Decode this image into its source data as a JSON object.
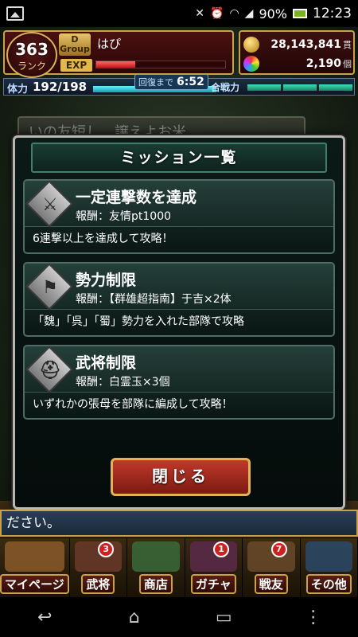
{
  "status_bar": {
    "battery": "90%",
    "time": "12:23",
    "icons": [
      "gallery-icon",
      "mute-icon",
      "alarm-icon",
      "wifi-icon",
      "signal-icon",
      "battery-icon"
    ]
  },
  "player": {
    "rank_value": "363",
    "rank_label": "ランク",
    "group_label": "D\nGroup",
    "name": "はぴ",
    "exp_label": "EXP",
    "exp_progress": 0.3
  },
  "currency": {
    "coins": "28,143,841",
    "coins_unit": "貫",
    "gems": "2,190",
    "gems_unit": "個"
  },
  "stamina": {
    "label": "体力",
    "value": "192/198",
    "progress": 0.97,
    "recover_label": "回復まで",
    "recover_time": "6:52",
    "power_label": "合戦力"
  },
  "background_banner": "いの友短し　譲えよお米",
  "dialog": {
    "title": "ミッション一覧",
    "missions": [
      {
        "icon": "sword-icon",
        "title": "一定連撃数を達成",
        "reward": "報酬：友情pt1000",
        "desc": "6連撃以上を達成して攻略！"
      },
      {
        "icon": "flag-icon",
        "title": "勢力制限",
        "reward": "報酬：【群雄超指南】于吉×2体",
        "desc": "「魏」「呉」「蜀」勢力を入れた部隊で攻略"
      },
      {
        "icon": "helmet-icon",
        "title": "武将制限",
        "reward": "報酬：白霊玉×3個",
        "desc": "いずれかの張母を部隊に編成して攻略！"
      }
    ],
    "close_label": "閉じる"
  },
  "message": "ださい。",
  "nav": [
    {
      "label": "マイページ",
      "badge": "",
      "color": "#8a5a2a"
    },
    {
      "label": "武将",
      "badge": "3",
      "color": "#6a3a2a"
    },
    {
      "label": "商店",
      "badge": "",
      "color": "#3a6a3a"
    },
    {
      "label": "ガチャ",
      "badge": "1",
      "color": "#5a2a4a"
    },
    {
      "label": "戦友",
      "badge": "7",
      "color": "#6a4a2a"
    },
    {
      "label": "その他",
      "badge": "",
      "color": "#2a4a6a"
    }
  ],
  "system_nav": {
    "back": "↩",
    "home": "⌂",
    "recents": "▭",
    "menu": "⋮"
  }
}
